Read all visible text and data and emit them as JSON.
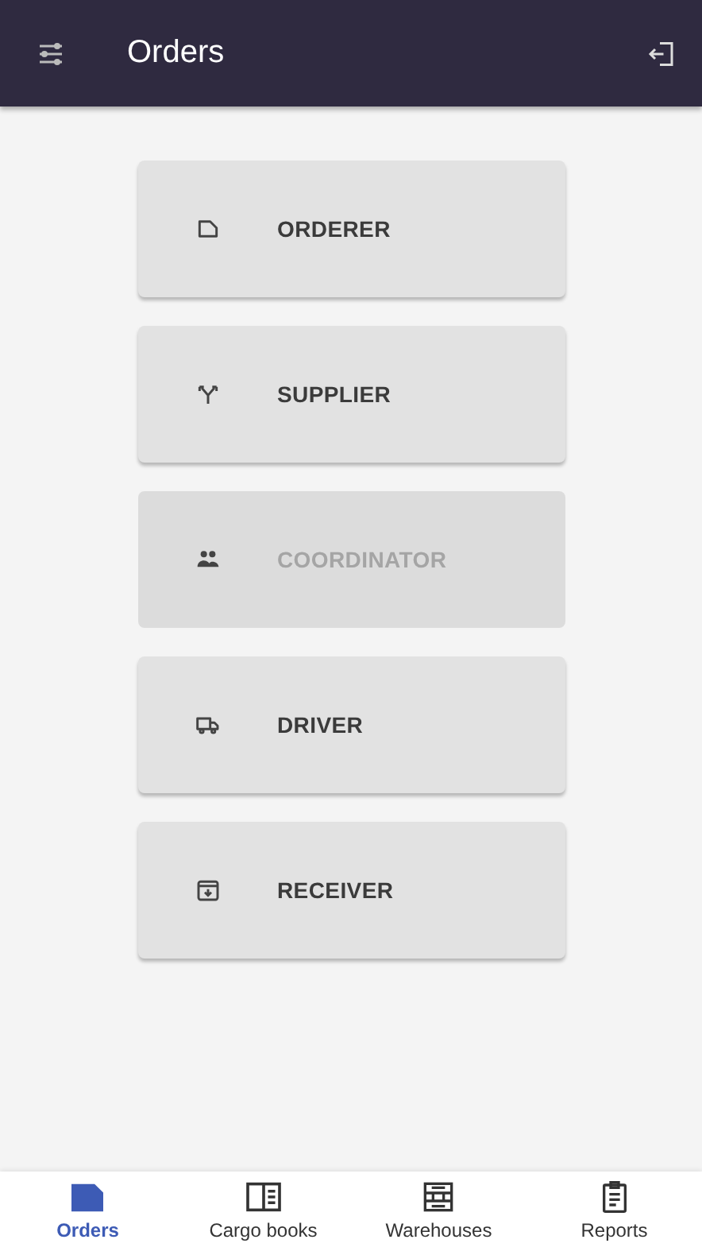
{
  "app_bar": {
    "title": "Orders"
  },
  "roles": [
    {
      "label": "ORDERER",
      "disabled": false
    },
    {
      "label": "SUPPLIER",
      "disabled": false
    },
    {
      "label": "COORDINATOR",
      "disabled": true
    },
    {
      "label": "DRIVER",
      "disabled": false
    },
    {
      "label": "RECEIVER",
      "disabled": false
    }
  ],
  "bottom_nav": [
    {
      "label": "Orders",
      "selected": true
    },
    {
      "label": "Cargo books",
      "selected": false
    },
    {
      "label": "Warehouses",
      "selected": false
    },
    {
      "label": "Reports",
      "selected": false
    }
  ]
}
